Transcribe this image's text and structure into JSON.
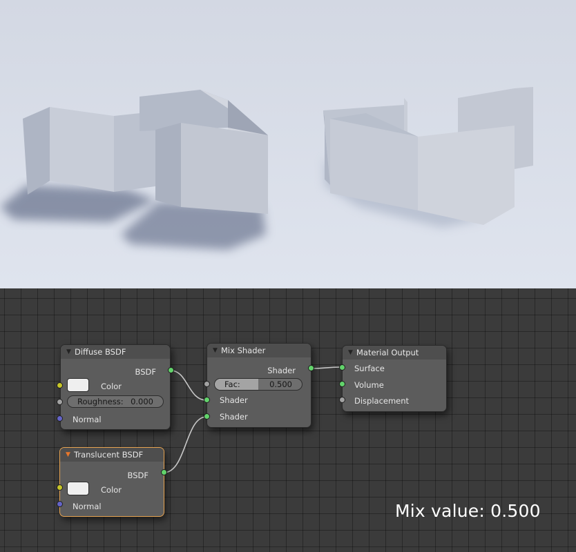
{
  "node_editor": {
    "caption": "Mix value: 0.500",
    "nodes": {
      "diffuse_bsdf": {
        "title": "Diffuse BSDF",
        "output_bsdf": "BSDF",
        "color_label": "Color",
        "roughness_label": "Roughness:",
        "roughness_value": "0.000",
        "normal_label": "Normal"
      },
      "mix_shader": {
        "title": "Mix Shader",
        "output_shader": "Shader",
        "fac_label": "Fac:",
        "fac_value": "0.500",
        "fac_fraction": 0.5,
        "input_shader_1": "Shader",
        "input_shader_2": "Shader"
      },
      "material_output": {
        "title": "Material Output",
        "surface": "Surface",
        "volume": "Volume",
        "displacement": "Displacement"
      },
      "translucent_bsdf": {
        "title": "Translucent BSDF",
        "output_bsdf": "BSDF",
        "color_label": "Color",
        "normal_label": "Normal"
      }
    },
    "colors": {
      "shader_socket": "#62d36b",
      "color_socket": "#c7c629",
      "float_socket": "#a2a2a2",
      "vector_socket": "#6464c8",
      "selected_outline": "#e8a451"
    },
    "icons": {
      "collapse": "triangle-down-icon"
    }
  }
}
